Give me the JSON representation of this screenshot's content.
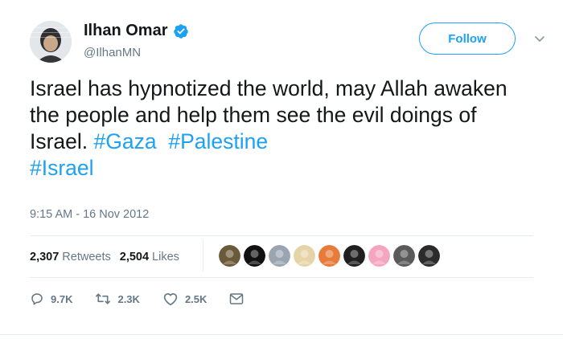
{
  "author": {
    "display_name": "Ilhan Omar",
    "handle": "@IlhanMN",
    "verified": true
  },
  "follow_button": {
    "label": "Follow"
  },
  "tweet": {
    "text_plain": "Israel has hypnotized the world, may Allah awaken the people and help them see the evil doings of Israel. ",
    "hashtags": [
      "#Gaza",
      "#Palestine",
      "#Israel"
    ],
    "timestamp": "9:15 AM - 16 Nov 2012"
  },
  "stats": {
    "retweets_count": "2,307",
    "retweets_label": "Retweets",
    "likes_count": "2,504",
    "likes_label": "Likes"
  },
  "liker_avatars": [
    {
      "name": "liker-avatar-1",
      "color": "#6b5a3a"
    },
    {
      "name": "liker-avatar-2",
      "color": "#111111"
    },
    {
      "name": "liker-avatar-3",
      "color": "#9aa5b1"
    },
    {
      "name": "liker-avatar-4",
      "color": "#e7d3a8"
    },
    {
      "name": "liker-avatar-5",
      "color": "#e87a3a"
    },
    {
      "name": "liker-avatar-6",
      "color": "#1f1f1f"
    },
    {
      "name": "liker-avatar-7",
      "color": "#f4a6c0"
    },
    {
      "name": "liker-avatar-8",
      "color": "#5a5a5a"
    },
    {
      "name": "liker-avatar-9",
      "color": "#2b2b2b"
    }
  ],
  "actions": {
    "replies": "9.7K",
    "retweets": "2.3K",
    "likes": "2.5K"
  },
  "colors": {
    "accent": "#1da1f2",
    "text": "#14171a",
    "muted": "#657786",
    "border": "#e6ecf0"
  },
  "icons": [
    "verified-badge-icon",
    "chevron-down-icon",
    "reply-icon",
    "retweet-icon",
    "heart-icon",
    "message-icon"
  ]
}
